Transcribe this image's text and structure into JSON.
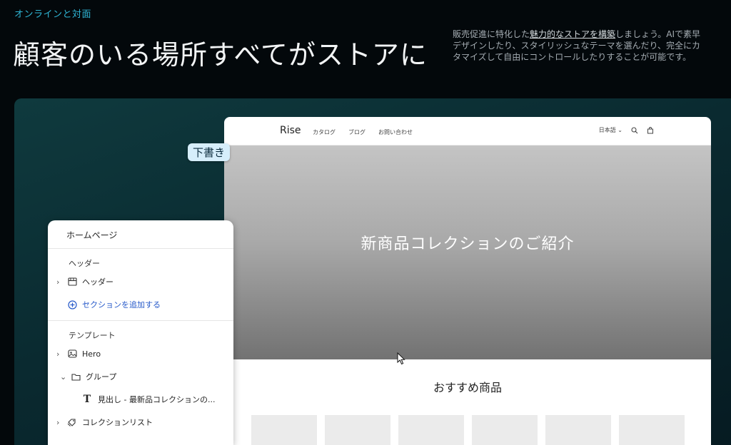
{
  "header": {
    "eyebrow": "オンラインと対面",
    "headline": "顧客のいる場所すべてがストアに",
    "intro": {
      "line1_pre": "販売促進に特化した",
      "line1_link": "魅力的なストアを構築",
      "line1_post": "しましょう。AIで素早",
      "line2": "デザインしたり、スタイリッシュなテーマを選んだり、完全にカ",
      "line3": "タマイズして自由にコントロールしたりすることが可能です。"
    }
  },
  "badge": {
    "label": "下書き"
  },
  "store": {
    "logo": "Rise",
    "nav": [
      "カタログ",
      "ブログ",
      "お問い合わせ"
    ],
    "language": "日本語",
    "hero_title": "新商品コレクションのご紹介",
    "featured_title": "おすすめ商品",
    "tile_count": 6
  },
  "panel": {
    "title": "ホームページ",
    "header_section": "ヘッダー",
    "header_item": "ヘッダー",
    "add_section": "セクションを追加する",
    "template_section": "テンプレート",
    "items": {
      "hero": "Hero",
      "group": "グループ",
      "heading": "見出し - 最新品コレクションの...",
      "collection_list": "コレクションリスト"
    }
  },
  "colors": {
    "accent": "#2fb6d6",
    "link": "#2659c9",
    "badge_bg": "#d6eefb"
  }
}
